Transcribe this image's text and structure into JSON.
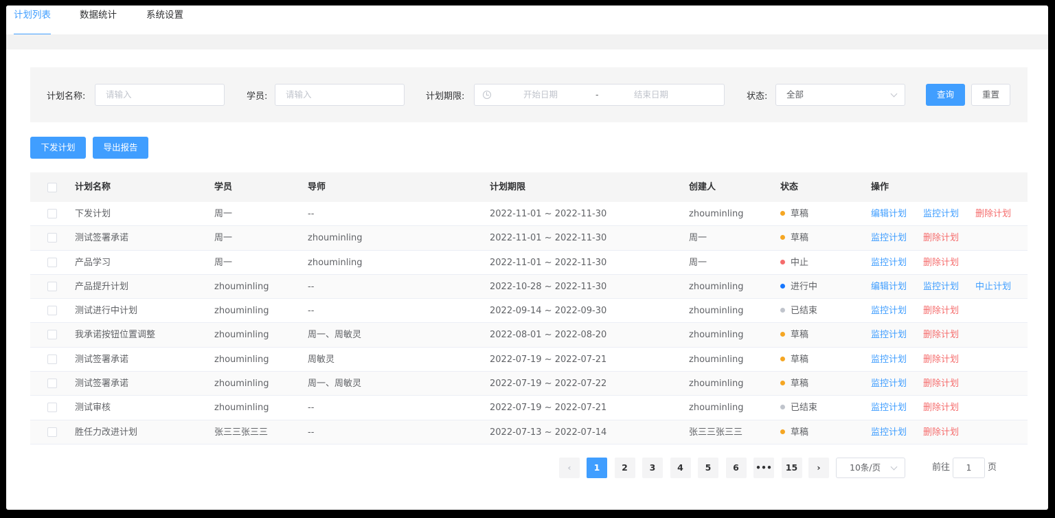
{
  "tabs": [
    "计划列表",
    "数据统计",
    "系统设置"
  ],
  "filter": {
    "plan_name_label": "计划名称:",
    "plan_name_placeholder": "请输入",
    "student_label": "学员:",
    "student_placeholder": "请输入",
    "period_label": "计划期限:",
    "start_placeholder": "开始日期",
    "range_sep": "-",
    "end_placeholder": "结束日期",
    "status_label": "状态:",
    "status_value": "全部",
    "query_button": "查询",
    "reset_button": "重置"
  },
  "actions": {
    "issue_button": "下发计划",
    "export_button": "导出报告"
  },
  "table": {
    "headers": [
      "计划名称",
      "学员",
      "导师",
      "计划期限",
      "创建人",
      "状态",
      "操作"
    ],
    "rows": [
      {
        "name": "下发计划",
        "student": "周一",
        "mentor": "--",
        "period": "2022-11-01 ~ 2022-11-30",
        "creator": "zhouminling",
        "status": "草稿",
        "status_color": "#f5a623",
        "ops": [
          {
            "label": "编辑计划",
            "type": "primary"
          },
          {
            "label": "监控计划",
            "type": "primary"
          },
          {
            "label": "删除计划",
            "type": "danger"
          }
        ]
      },
      {
        "name": "测试签署承诺",
        "student": "周一",
        "mentor": "zhouminling",
        "period": "2022-11-01 ~ 2022-11-30",
        "creator": "周一",
        "status": "草稿",
        "status_color": "#f5a623",
        "ops": [
          {
            "label": "监控计划",
            "type": "primary"
          },
          {
            "label": "删除计划",
            "type": "danger"
          }
        ]
      },
      {
        "name": "产品学习",
        "student": "周一",
        "mentor": "zhouminling",
        "period": "2022-11-01 ~ 2022-11-30",
        "creator": "周一",
        "status": "中止",
        "status_color": "#f56c6c",
        "ops": [
          {
            "label": "监控计划",
            "type": "primary"
          },
          {
            "label": "删除计划",
            "type": "danger"
          }
        ]
      },
      {
        "name": "产品提升计划",
        "student": "zhouminling",
        "mentor": "--",
        "period": "2022-10-28 ~ 2022-11-30",
        "creator": "zhouminling",
        "status": "进行中",
        "status_color": "#1677ff",
        "ops": [
          {
            "label": "编辑计划",
            "type": "primary"
          },
          {
            "label": "监控计划",
            "type": "primary"
          },
          {
            "label": "中止计划",
            "type": "primary"
          }
        ]
      },
      {
        "name": "测试进行中计划",
        "student": "zhouminling",
        "mentor": "--",
        "period": "2022-09-14 ~ 2022-09-30",
        "creator": "zhouminling",
        "status": "已结束",
        "status_color": "#c0c4cc",
        "ops": [
          {
            "label": "监控计划",
            "type": "primary"
          },
          {
            "label": "删除计划",
            "type": "danger"
          }
        ]
      },
      {
        "name": "我承诺按钮位置调整",
        "student": "zhouminling",
        "mentor": "周一、周敏灵",
        "period": "2022-08-01 ~ 2022-08-20",
        "creator": "zhouminling",
        "status": "草稿",
        "status_color": "#f5a623",
        "ops": [
          {
            "label": "监控计划",
            "type": "primary"
          },
          {
            "label": "删除计划",
            "type": "danger"
          }
        ]
      },
      {
        "name": "测试签署承诺",
        "student": "zhouminling",
        "mentor": "周敏灵",
        "period": "2022-07-19 ~ 2022-07-21",
        "creator": "zhouminling",
        "status": "草稿",
        "status_color": "#f5a623",
        "ops": [
          {
            "label": "监控计划",
            "type": "primary"
          },
          {
            "label": "删除计划",
            "type": "danger"
          }
        ]
      },
      {
        "name": "测试签署承诺",
        "student": "zhouminling",
        "mentor": "周一、周敏灵",
        "period": "2022-07-19 ~ 2022-07-22",
        "creator": "zhouminling",
        "status": "草稿",
        "status_color": "#f5a623",
        "ops": [
          {
            "label": "监控计划",
            "type": "primary"
          },
          {
            "label": "删除计划",
            "type": "danger"
          }
        ]
      },
      {
        "name": "测试审核",
        "student": "zhouminling",
        "mentor": "--",
        "period": "2022-07-19 ~ 2022-07-21",
        "creator": "zhouminling",
        "status": "已结束",
        "status_color": "#c0c4cc",
        "ops": [
          {
            "label": "监控计划",
            "type": "primary"
          },
          {
            "label": "删除计划",
            "type": "danger"
          }
        ]
      },
      {
        "name": "胜任力改进计划",
        "student": "张三三张三三",
        "mentor": "--",
        "period": "2022-07-13 ~ 2022-07-14",
        "creator": "张三三张三三",
        "status": "草稿",
        "status_color": "#f5a623",
        "ops": [
          {
            "label": "监控计划",
            "type": "primary"
          },
          {
            "label": "删除计划",
            "type": "danger"
          }
        ]
      }
    ]
  },
  "pagination": {
    "prev": "‹",
    "pages": [
      "1",
      "2",
      "3",
      "4",
      "5",
      "6",
      "•••",
      "15"
    ],
    "active_page": "1",
    "next": "›",
    "page_size": "10条/页",
    "goto_label": "前往",
    "goto_value": "1",
    "goto_suffix": "页"
  }
}
